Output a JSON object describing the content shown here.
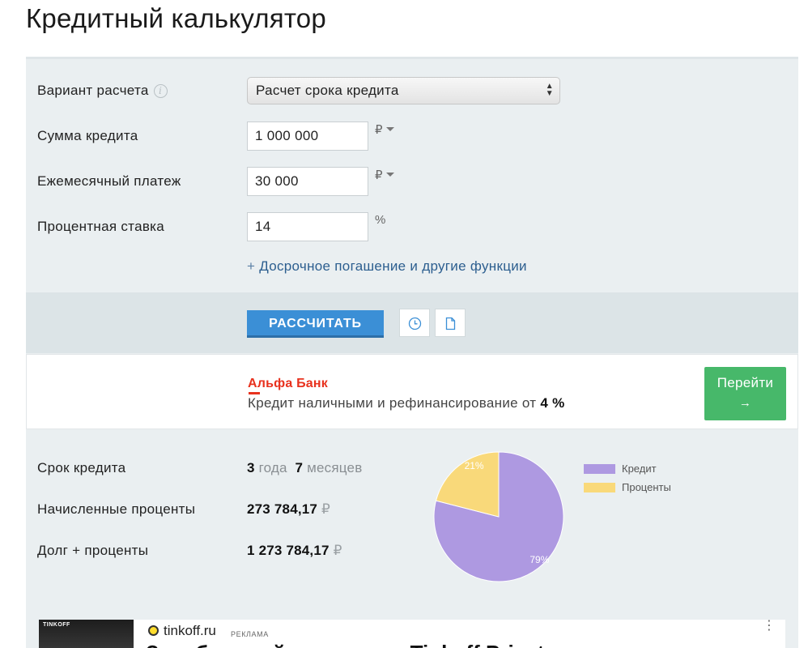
{
  "title": "Кредитный калькулятор",
  "form": {
    "variant_label": "Вариант расчета",
    "variant_info_icon": "ⓘ",
    "variant_value": "Расчет срока кредита",
    "amount_label": "Сумма кредита",
    "amount_value": "1 000 000",
    "amount_unit": "₽",
    "payment_label": "Ежемесячный платеж",
    "payment_value": "30 000",
    "payment_unit": "₽",
    "rate_label": "Процентная ставка",
    "rate_value": "14",
    "rate_unit": "%",
    "more_link": "Досрочное погашение и другие функции"
  },
  "actions": {
    "calculate": "РАССЧИТАТЬ",
    "history_icon": "clock-icon",
    "document_icon": "document-icon"
  },
  "ad": {
    "bank": "Альфа Банк",
    "text": "Кредит наличными и рефинансирование от",
    "rate": "4 %",
    "button": "Перейти",
    "button_arrow": "→"
  },
  "results": {
    "term_label": "Срок кредита",
    "term_years": "3",
    "term_years_unit": "года",
    "term_months": "7",
    "term_months_unit": "месяцев",
    "interest_label": "Начисленные проценты",
    "interest_value": "273 784,17",
    "total_label": "Долг + проценты",
    "total_value": "1 273 784,17",
    "currency": "₽"
  },
  "chart_data": {
    "type": "pie",
    "title": "",
    "series": [
      {
        "name": "Кредит",
        "value": 79,
        "label": "79%",
        "color": "#ae99e1"
      },
      {
        "name": "Проценты",
        "value": 21,
        "label": "21%",
        "color": "#f9d97a"
      }
    ],
    "legend": "right"
  },
  "ad2": {
    "domain": "tinkoff.ru",
    "tag": "РЕКЛАМА",
    "thumb_text": "TINKOFF",
    "headline": "Зарабатывайте вместе с Tinkoff Private",
    "menu": "⋮"
  }
}
